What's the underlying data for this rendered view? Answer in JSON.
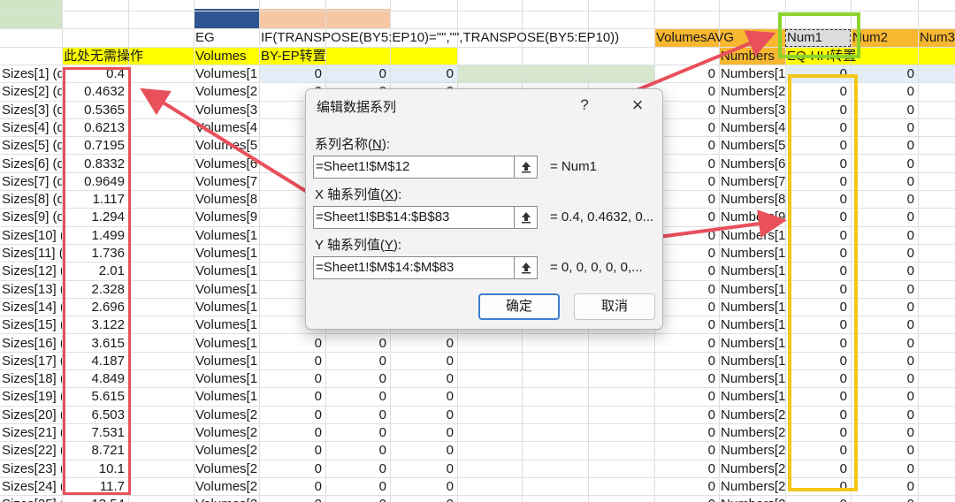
{
  "sheet": {
    "headers": {
      "colA_title": "此处无需操作",
      "colC_row1": "EG",
      "colC_row2": "Volumes",
      "colD_formula": "IF(TRANSPOSE(BY5:EP10)=\"\",\"\",TRANSPOSE(BY5:EP10))",
      "colD_row2": "BY-EP转置",
      "colK_row1": "VolumesAVG",
      "colK_row2": "Numbers",
      "colL_row1": "Num1",
      "colL_row2": "EQ-HH转置",
      "colM_row1": "Num2",
      "colN_row1": "Num3"
    },
    "rows": [
      {
        "a": "Sizes[1] (d",
        "b": "0.4",
        "c": "Volumes[1",
        "k": "Numbers[1"
      },
      {
        "a": "Sizes[2] (d",
        "b": "0.4632",
        "c": "Volumes[2",
        "k": "Numbers[2"
      },
      {
        "a": "Sizes[3] (d",
        "b": "0.5365",
        "c": "Volumes[3",
        "k": "Numbers[3"
      },
      {
        "a": "Sizes[4] (d",
        "b": "0.6213",
        "c": "Volumes[4",
        "k": "Numbers[4"
      },
      {
        "a": "Sizes[5] (d",
        "b": "0.7195",
        "c": "Volumes[5",
        "k": "Numbers[5"
      },
      {
        "a": "Sizes[6] (d",
        "b": "0.8332",
        "c": "Volumes[6",
        "k": "Numbers[6"
      },
      {
        "a": "Sizes[7] (d",
        "b": "0.9649",
        "c": "Volumes[7",
        "k": "Numbers[7"
      },
      {
        "a": "Sizes[8] (d",
        "b": "1.117",
        "c": "Volumes[8",
        "k": "Numbers[8"
      },
      {
        "a": "Sizes[9] (d",
        "b": "1.294",
        "c": "Volumes[9",
        "k": "Numbers[9"
      },
      {
        "a": "Sizes[10] (",
        "b": "1.499",
        "c": "Volumes[1",
        "k": "Numbers[1"
      },
      {
        "a": "Sizes[11] (",
        "b": "1.736",
        "c": "Volumes[1",
        "k": "Numbers[1"
      },
      {
        "a": "Sizes[12] (",
        "b": "2.01",
        "c": "Volumes[1",
        "k": "Numbers[1"
      },
      {
        "a": "Sizes[13] (",
        "b": "2.328",
        "c": "Volumes[1",
        "k": "Numbers[1"
      },
      {
        "a": "Sizes[14] (",
        "b": "2.696",
        "c": "Volumes[1",
        "k": "Numbers[1"
      },
      {
        "a": "Sizes[15] (",
        "b": "3.122",
        "c": "Volumes[1",
        "k": "Numbers[1"
      },
      {
        "a": "Sizes[16] (",
        "b": "3.615",
        "c": "Volumes[1",
        "k": "Numbers[1"
      },
      {
        "a": "Sizes[17] (",
        "b": "4.187",
        "c": "Volumes[1",
        "k": "Numbers[1"
      },
      {
        "a": "Sizes[18] (",
        "b": "4.849",
        "c": "Volumes[1",
        "k": "Numbers[1"
      },
      {
        "a": "Sizes[19] (",
        "b": "5.615",
        "c": "Volumes[1",
        "k": "Numbers[1"
      },
      {
        "a": "Sizes[20] (",
        "b": "6.503",
        "c": "Volumes[2",
        "k": "Numbers[2"
      },
      {
        "a": "Sizes[21] (",
        "b": "7.531",
        "c": "Volumes[2",
        "k": "Numbers[2"
      },
      {
        "a": "Sizes[22] (",
        "b": "8.721",
        "c": "Volumes[2",
        "k": "Numbers[2"
      },
      {
        "a": "Sizes[23] (",
        "b": "10.1",
        "c": "Volumes[2",
        "k": "Numbers[2"
      },
      {
        "a": "Sizes[24] (",
        "b": "11.7",
        "c": "Volumes[2",
        "k": "Numbers[2"
      },
      {
        "a": "Sizes[25] (",
        "b": "13.54",
        "c": "Volumes[2",
        "k": "Numbers[2"
      }
    ],
    "zero": "0"
  },
  "dialog": {
    "title": "编辑数据系列",
    "help_icon": "?",
    "close_icon": "×",
    "series_name_label": "系列名称(",
    "series_name_key": "N",
    "series_name_label_end": "):",
    "series_name_value": "=Sheet1!$M$12",
    "series_name_preview": "= Num1",
    "x_label": "X 轴系列值(",
    "x_key": "X",
    "x_label_end": "):",
    "x_value": "=Sheet1!$B$14:$B$83",
    "x_preview": "= 0.4, 0.4632, 0...",
    "y_label": "Y 轴系列值(",
    "y_key": "Y",
    "y_label_end": "):",
    "y_value": "=Sheet1!$M$14:$M$83",
    "y_preview": "= 0, 0, 0, 0, 0,...",
    "ok": "确定",
    "cancel": "取消"
  },
  "colors": {
    "header_yellow": "#ffff00",
    "orange_header": "#f7b731",
    "highlight_red": "#e8505b",
    "highlight_green": "#8bd42a",
    "highlight_yellow": "#f5c518",
    "arrow_red": "#e8505b",
    "accent_blue": "#3c7fd0"
  },
  "icons": {
    "collapse_ref": "arrow-up-icon"
  }
}
